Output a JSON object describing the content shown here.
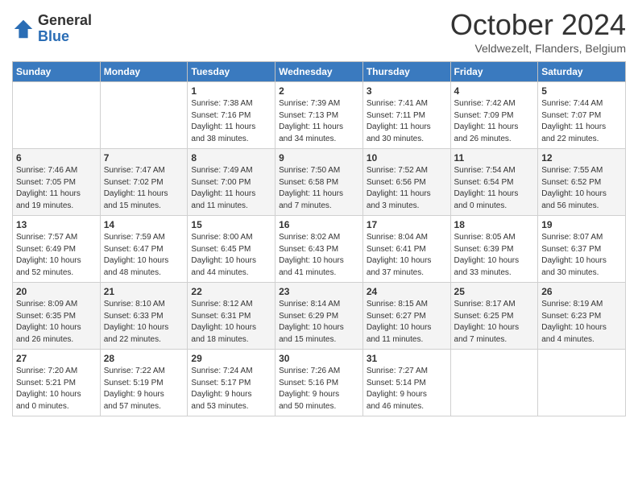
{
  "header": {
    "logo_general": "General",
    "logo_blue": "Blue",
    "month_title": "October 2024",
    "subtitle": "Veldwezelt, Flanders, Belgium"
  },
  "days_of_week": [
    "Sunday",
    "Monday",
    "Tuesday",
    "Wednesday",
    "Thursday",
    "Friday",
    "Saturday"
  ],
  "weeks": [
    [
      {
        "day": "",
        "info": ""
      },
      {
        "day": "",
        "info": ""
      },
      {
        "day": "1",
        "info": "Sunrise: 7:38 AM\nSunset: 7:16 PM\nDaylight: 11 hours\nand 38 minutes."
      },
      {
        "day": "2",
        "info": "Sunrise: 7:39 AM\nSunset: 7:13 PM\nDaylight: 11 hours\nand 34 minutes."
      },
      {
        "day": "3",
        "info": "Sunrise: 7:41 AM\nSunset: 7:11 PM\nDaylight: 11 hours\nand 30 minutes."
      },
      {
        "day": "4",
        "info": "Sunrise: 7:42 AM\nSunset: 7:09 PM\nDaylight: 11 hours\nand 26 minutes."
      },
      {
        "day": "5",
        "info": "Sunrise: 7:44 AM\nSunset: 7:07 PM\nDaylight: 11 hours\nand 22 minutes."
      }
    ],
    [
      {
        "day": "6",
        "info": "Sunrise: 7:46 AM\nSunset: 7:05 PM\nDaylight: 11 hours\nand 19 minutes."
      },
      {
        "day": "7",
        "info": "Sunrise: 7:47 AM\nSunset: 7:02 PM\nDaylight: 11 hours\nand 15 minutes."
      },
      {
        "day": "8",
        "info": "Sunrise: 7:49 AM\nSunset: 7:00 PM\nDaylight: 11 hours\nand 11 minutes."
      },
      {
        "day": "9",
        "info": "Sunrise: 7:50 AM\nSunset: 6:58 PM\nDaylight: 11 hours\nand 7 minutes."
      },
      {
        "day": "10",
        "info": "Sunrise: 7:52 AM\nSunset: 6:56 PM\nDaylight: 11 hours\nand 3 minutes."
      },
      {
        "day": "11",
        "info": "Sunrise: 7:54 AM\nSunset: 6:54 PM\nDaylight: 11 hours\nand 0 minutes."
      },
      {
        "day": "12",
        "info": "Sunrise: 7:55 AM\nSunset: 6:52 PM\nDaylight: 10 hours\nand 56 minutes."
      }
    ],
    [
      {
        "day": "13",
        "info": "Sunrise: 7:57 AM\nSunset: 6:49 PM\nDaylight: 10 hours\nand 52 minutes."
      },
      {
        "day": "14",
        "info": "Sunrise: 7:59 AM\nSunset: 6:47 PM\nDaylight: 10 hours\nand 48 minutes."
      },
      {
        "day": "15",
        "info": "Sunrise: 8:00 AM\nSunset: 6:45 PM\nDaylight: 10 hours\nand 44 minutes."
      },
      {
        "day": "16",
        "info": "Sunrise: 8:02 AM\nSunset: 6:43 PM\nDaylight: 10 hours\nand 41 minutes."
      },
      {
        "day": "17",
        "info": "Sunrise: 8:04 AM\nSunset: 6:41 PM\nDaylight: 10 hours\nand 37 minutes."
      },
      {
        "day": "18",
        "info": "Sunrise: 8:05 AM\nSunset: 6:39 PM\nDaylight: 10 hours\nand 33 minutes."
      },
      {
        "day": "19",
        "info": "Sunrise: 8:07 AM\nSunset: 6:37 PM\nDaylight: 10 hours\nand 30 minutes."
      }
    ],
    [
      {
        "day": "20",
        "info": "Sunrise: 8:09 AM\nSunset: 6:35 PM\nDaylight: 10 hours\nand 26 minutes."
      },
      {
        "day": "21",
        "info": "Sunrise: 8:10 AM\nSunset: 6:33 PM\nDaylight: 10 hours\nand 22 minutes."
      },
      {
        "day": "22",
        "info": "Sunrise: 8:12 AM\nSunset: 6:31 PM\nDaylight: 10 hours\nand 18 minutes."
      },
      {
        "day": "23",
        "info": "Sunrise: 8:14 AM\nSunset: 6:29 PM\nDaylight: 10 hours\nand 15 minutes."
      },
      {
        "day": "24",
        "info": "Sunrise: 8:15 AM\nSunset: 6:27 PM\nDaylight: 10 hours\nand 11 minutes."
      },
      {
        "day": "25",
        "info": "Sunrise: 8:17 AM\nSunset: 6:25 PM\nDaylight: 10 hours\nand 7 minutes."
      },
      {
        "day": "26",
        "info": "Sunrise: 8:19 AM\nSunset: 6:23 PM\nDaylight: 10 hours\nand 4 minutes."
      }
    ],
    [
      {
        "day": "27",
        "info": "Sunrise: 7:20 AM\nSunset: 5:21 PM\nDaylight: 10 hours\nand 0 minutes."
      },
      {
        "day": "28",
        "info": "Sunrise: 7:22 AM\nSunset: 5:19 PM\nDaylight: 9 hours\nand 57 minutes."
      },
      {
        "day": "29",
        "info": "Sunrise: 7:24 AM\nSunset: 5:17 PM\nDaylight: 9 hours\nand 53 minutes."
      },
      {
        "day": "30",
        "info": "Sunrise: 7:26 AM\nSunset: 5:16 PM\nDaylight: 9 hours\nand 50 minutes."
      },
      {
        "day": "31",
        "info": "Sunrise: 7:27 AM\nSunset: 5:14 PM\nDaylight: 9 hours\nand 46 minutes."
      },
      {
        "day": "",
        "info": ""
      },
      {
        "day": "",
        "info": ""
      }
    ]
  ]
}
